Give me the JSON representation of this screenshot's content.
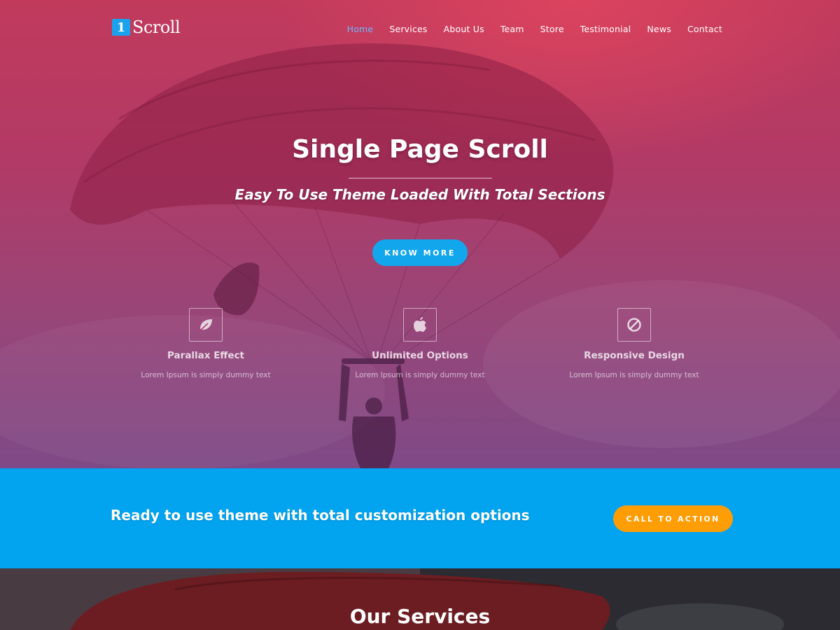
{
  "header": {
    "logo_badge": "1",
    "logo_text": "Scroll",
    "nav": [
      {
        "label": "Home",
        "active": true
      },
      {
        "label": "Services"
      },
      {
        "label": "About Us"
      },
      {
        "label": "Team"
      },
      {
        "label": "Store"
      },
      {
        "label": "Testimonial"
      },
      {
        "label": "News"
      },
      {
        "label": "Contact"
      }
    ]
  },
  "hero": {
    "title": "Single Page Scroll",
    "subtitle": "Easy To Use Theme Loaded With Total Sections",
    "button_label": "KNOW MORE"
  },
  "features": [
    {
      "icon": "leaf-icon",
      "title": "Parallax Effect",
      "text": "Lorem Ipsum is simply dummy text"
    },
    {
      "icon": "apple-icon",
      "title": "Unlimited Options",
      "text": "Lorem Ipsum is simply dummy text"
    },
    {
      "icon": "ban-icon",
      "title": "Responsive Design",
      "text": "Lorem Ipsum is simply dummy text"
    }
  ],
  "cta": {
    "text": "Ready to use theme with total customization options",
    "button_label": "CALL TO ACTION"
  },
  "services": {
    "title": "Our Services"
  },
  "colors": {
    "accent_blue": "#02a3ef",
    "button_blue": "#12a6ec",
    "cta_orange": "#ff9d05",
    "nav_active": "#6fb4ff"
  }
}
